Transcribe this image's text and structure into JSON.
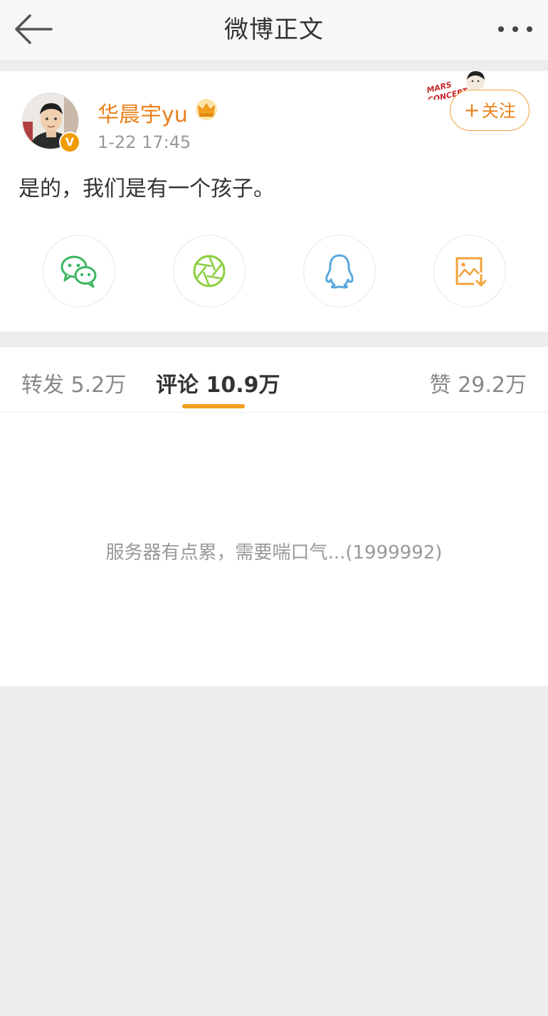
{
  "header": {
    "title": "微博正文"
  },
  "post": {
    "author": "华晨宇yu",
    "timestamp": "1-22 17:45",
    "follow_label": "关注",
    "vip_badge": "V",
    "text": "是的，我们是有一个孩子。",
    "sticker_text": "MARS CONCERT"
  },
  "share": [
    {
      "name": "wechat-icon",
      "color": "#3bb55f"
    },
    {
      "name": "moments-icon",
      "color": "#8ccf3f"
    },
    {
      "name": "qq-icon",
      "color": "#5aa8dd"
    },
    {
      "name": "save-image-icon",
      "color": "#f2a33a"
    }
  ],
  "tabs": {
    "repost": "转发 5.2万",
    "comments": "评论 10.9万",
    "likes": "赞 29.2万"
  },
  "comments": {
    "error_message": "服务器有点累，需要喘口气...(1999992)"
  },
  "colors": {
    "accent": "#e8811b",
    "underline": "#f39d1e"
  }
}
